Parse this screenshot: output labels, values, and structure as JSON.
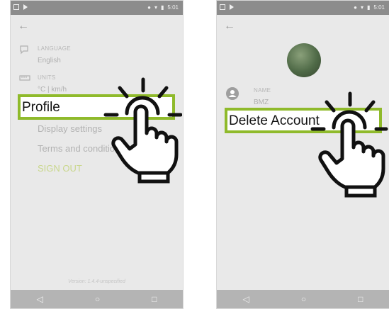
{
  "left_screen": {
    "status_time": "5:01",
    "back_glyph": "←",
    "language_label": "LANGUAGE",
    "language_value": "English",
    "units_label": "UNITS",
    "units_value": "°C | km/h",
    "highlighted_item": "Profile",
    "menu_items": [
      "Display settings",
      "Terms and conditions"
    ],
    "sign_out": "SIGN OUT",
    "version": "Version: 1.4.4-unspecified"
  },
  "right_screen": {
    "status_time": "5:01",
    "back_glyph": "←",
    "name_label": "NAME",
    "name_value": "BMZ",
    "highlighted_item": "Delete Account"
  },
  "nav": {
    "back": "◁",
    "home": "○",
    "recent": "□"
  },
  "colors": {
    "highlight": "#8fba2b",
    "sign_out": "#c9d78c"
  },
  "icons": [
    "back-arrow-icon",
    "chat-bubble-icon",
    "ruler-icon",
    "person-icon",
    "pointing-hand-icon"
  ]
}
